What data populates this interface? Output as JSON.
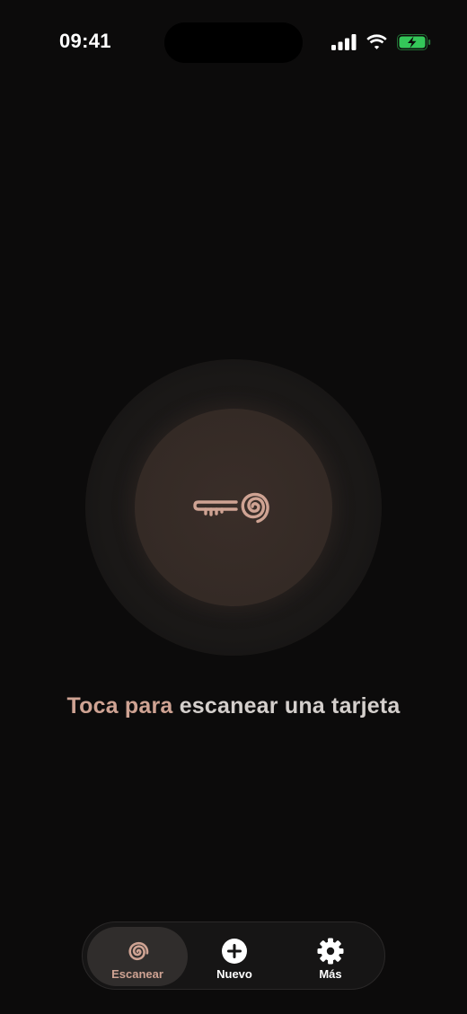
{
  "status_bar": {
    "time": "09:41",
    "icons": [
      "cellular-signal-icon",
      "wifi-icon",
      "battery-charging-icon"
    ],
    "battery_color": "#34c759"
  },
  "scan": {
    "icon": "key-with-spiral-icon",
    "prompt_part_1": "Toca para",
    "prompt_part_2": " escanear una tarjeta"
  },
  "tab_bar": {
    "active_index": 0,
    "items": [
      {
        "label": "Escanear",
        "icon": "spiral-icon"
      },
      {
        "label": "Nuevo",
        "icon": "plus-circle-icon"
      },
      {
        "label": "Más",
        "icon": "gear-icon"
      }
    ]
  },
  "colors": {
    "background": "#0c0b0b",
    "accent": "#cfa393",
    "text_muted": "#d4cfcc",
    "scan_core": "#3a2e29"
  }
}
